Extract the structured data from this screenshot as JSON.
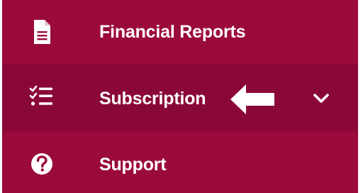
{
  "menu": {
    "items": [
      {
        "label": "Financial Reports",
        "icon": "document-icon"
      },
      {
        "label": "Subscription",
        "icon": "checklist-icon",
        "expandable": true,
        "active": true
      },
      {
        "label": "Support",
        "icon": "question-circle-icon"
      }
    ]
  },
  "colors": {
    "menu_background": "#9b0a3d",
    "active_background": "#8a0838",
    "text": "#ffffff"
  }
}
